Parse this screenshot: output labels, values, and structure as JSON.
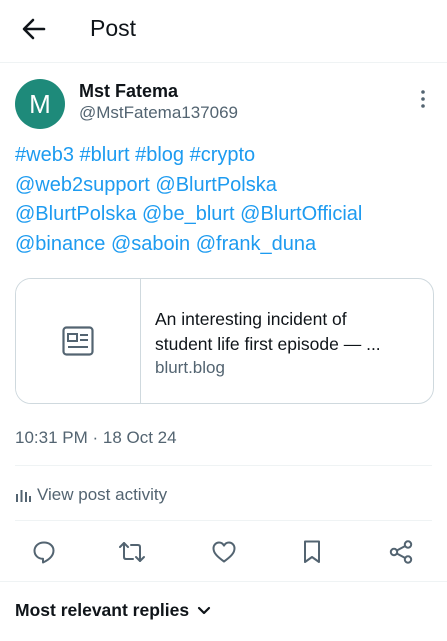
{
  "header": {
    "title": "Post",
    "back_icon": "arrow-left-icon"
  },
  "author": {
    "avatar_letter": "M",
    "avatar_color": "#1e8a7a",
    "name": "Mst Fatema",
    "handle": "@MstFatema137069"
  },
  "post": {
    "line1": [
      "#web3",
      "#blurt",
      "#blog",
      "#crypto"
    ],
    "line2": [
      "@web2support",
      "@BlurtPolska"
    ],
    "line3": [
      "@BlurtPolska",
      "@be_blurt",
      "@BlurtOfficial"
    ],
    "line4": [
      "@binance",
      "@saboin",
      "@frank_duna"
    ],
    "link_color": "#1d9bf0"
  },
  "link_card": {
    "title_line1": "An interesting incident of",
    "title_line2": "student life first episode — ...",
    "domain": "blurt.blog",
    "thumb_icon": "article-icon"
  },
  "meta": {
    "timestamp": "10:31 PM · 18 Oct 24"
  },
  "activity": {
    "label": "View post activity",
    "icon": "bar-chart-icon"
  },
  "actions": [
    "reply-icon",
    "repost-icon",
    "like-icon",
    "bookmark-icon",
    "share-icon"
  ],
  "replies": {
    "sort_label": "Most relevant replies",
    "icon": "chevron-down-icon"
  }
}
